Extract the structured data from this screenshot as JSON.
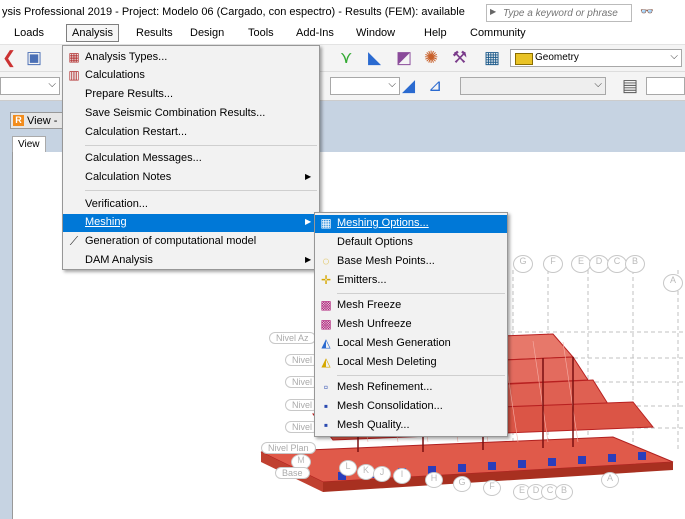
{
  "titlebar": {
    "title": "ysis Professional 2019 - Project: Modelo 06 (Cargado, con espectro) - Results (FEM): available",
    "search_placeholder": "Type a keyword or phrase"
  },
  "menubar": [
    "Loads",
    "Analysis",
    "Results",
    "Design",
    "Tools",
    "Add-Ins",
    "Window",
    "Help",
    "Community"
  ],
  "toolbar": {
    "geometry_label": "Geometry"
  },
  "view": {
    "title": "View -",
    "tab": "View"
  },
  "analysis_menu": {
    "items": [
      {
        "label": "Analysis Types...",
        "icon": "analysis-types-icon"
      },
      {
        "label": "Calculations",
        "icon": "calculations-icon"
      },
      {
        "label": "Prepare Results..."
      },
      {
        "label": "Save Seismic Combination Results..."
      },
      {
        "label": "Calculation Restart..."
      },
      {
        "label": "Calculation Messages..."
      },
      {
        "label": "Calculation Notes",
        "submenu": true
      },
      {
        "label": "Verification..."
      },
      {
        "label": "Meshing",
        "submenu": true,
        "highlighted": true
      },
      {
        "label": "Generation of computational model",
        "icon": "generation-icon"
      },
      {
        "label": "DAM Analysis",
        "submenu": true
      }
    ]
  },
  "meshing_menu": {
    "items": [
      {
        "label": "Meshing Options...",
        "icon": "meshing-options-icon",
        "highlighted": true
      },
      {
        "label": "Default Options"
      },
      {
        "label": "Base Mesh Points...",
        "icon": "base-mesh-points-icon"
      },
      {
        "label": "Emitters...",
        "icon": "emitters-icon"
      },
      {
        "label": "Mesh Freeze",
        "icon": "mesh-freeze-icon"
      },
      {
        "label": "Mesh Unfreeze",
        "icon": "mesh-unfreeze-icon"
      },
      {
        "label": "Local Mesh Generation",
        "icon": "local-mesh-generation-icon"
      },
      {
        "label": "Local Mesh Deleting",
        "icon": "local-mesh-deleting-icon"
      },
      {
        "label": "Mesh Refinement...",
        "icon": "mesh-refinement-icon"
      },
      {
        "label": "Mesh Consolidation...",
        "icon": "mesh-consolidation-icon"
      },
      {
        "label": "Mesh Quality...",
        "icon": "mesh-quality-icon"
      }
    ]
  },
  "model": {
    "grid_labels_top": [
      "G",
      "F",
      "E",
      "D",
      "C",
      "B",
      "A"
    ],
    "grid_labels_bottom": [
      "M",
      "L",
      "K",
      "J",
      "I",
      "H",
      "G",
      "F",
      "E",
      "D",
      "C",
      "B",
      "A"
    ],
    "level_labels": [
      "Nivel Az",
      "Nivel",
      "Nivel",
      "Nivel",
      "Nivel",
      "Nivel Plan",
      "Base"
    ]
  },
  "colors": {
    "highlight": "#0078d7",
    "model_red": "#d42020",
    "model_blue": "#2a3dbb",
    "workspace_bg": "#c6d3e2"
  }
}
